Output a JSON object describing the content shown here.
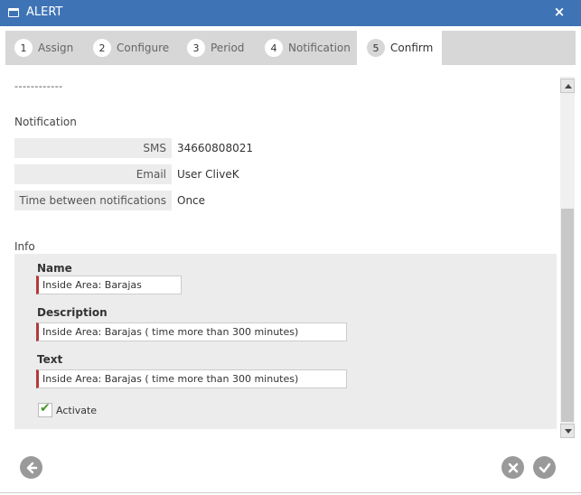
{
  "window": {
    "title": "ALERT",
    "icon": "window-icon",
    "close_label": "×"
  },
  "tabs": [
    {
      "num": "1",
      "label": "Assign"
    },
    {
      "num": "2",
      "label": "Configure"
    },
    {
      "num": "3",
      "label": "Period"
    },
    {
      "num": "4",
      "label": "Notification"
    },
    {
      "num": "5",
      "label": "Confirm",
      "active": true
    }
  ],
  "separator": "------------",
  "notification": {
    "title": "Notification",
    "rows": [
      {
        "label": "SMS",
        "value": "34660808021"
      },
      {
        "label": "Email",
        "value": "User CliveK"
      },
      {
        "label": "Time between notifications",
        "value": "Once"
      }
    ]
  },
  "info": {
    "title": "Info",
    "name_label": "Name",
    "name_value": "Inside Area: Barajas",
    "description_label": "Description",
    "description_value": "Inside Area: Barajas ( time more than 300 minutes)",
    "text_label": "Text",
    "text_value": "Inside Area: Barajas ( time more than 300 minutes)",
    "activate_label": "Activate",
    "activate_checked": true
  },
  "footer": {
    "back_icon": "back-arrow-icon",
    "cancel_icon": "cancel-x-icon",
    "confirm_icon": "confirm-check-icon"
  },
  "colors": {
    "titlebar": "#3e74b6",
    "tabstrip": "#d7d7d7",
    "required_marker": "#b23a3a",
    "button_gray": "#9a9a9a"
  }
}
